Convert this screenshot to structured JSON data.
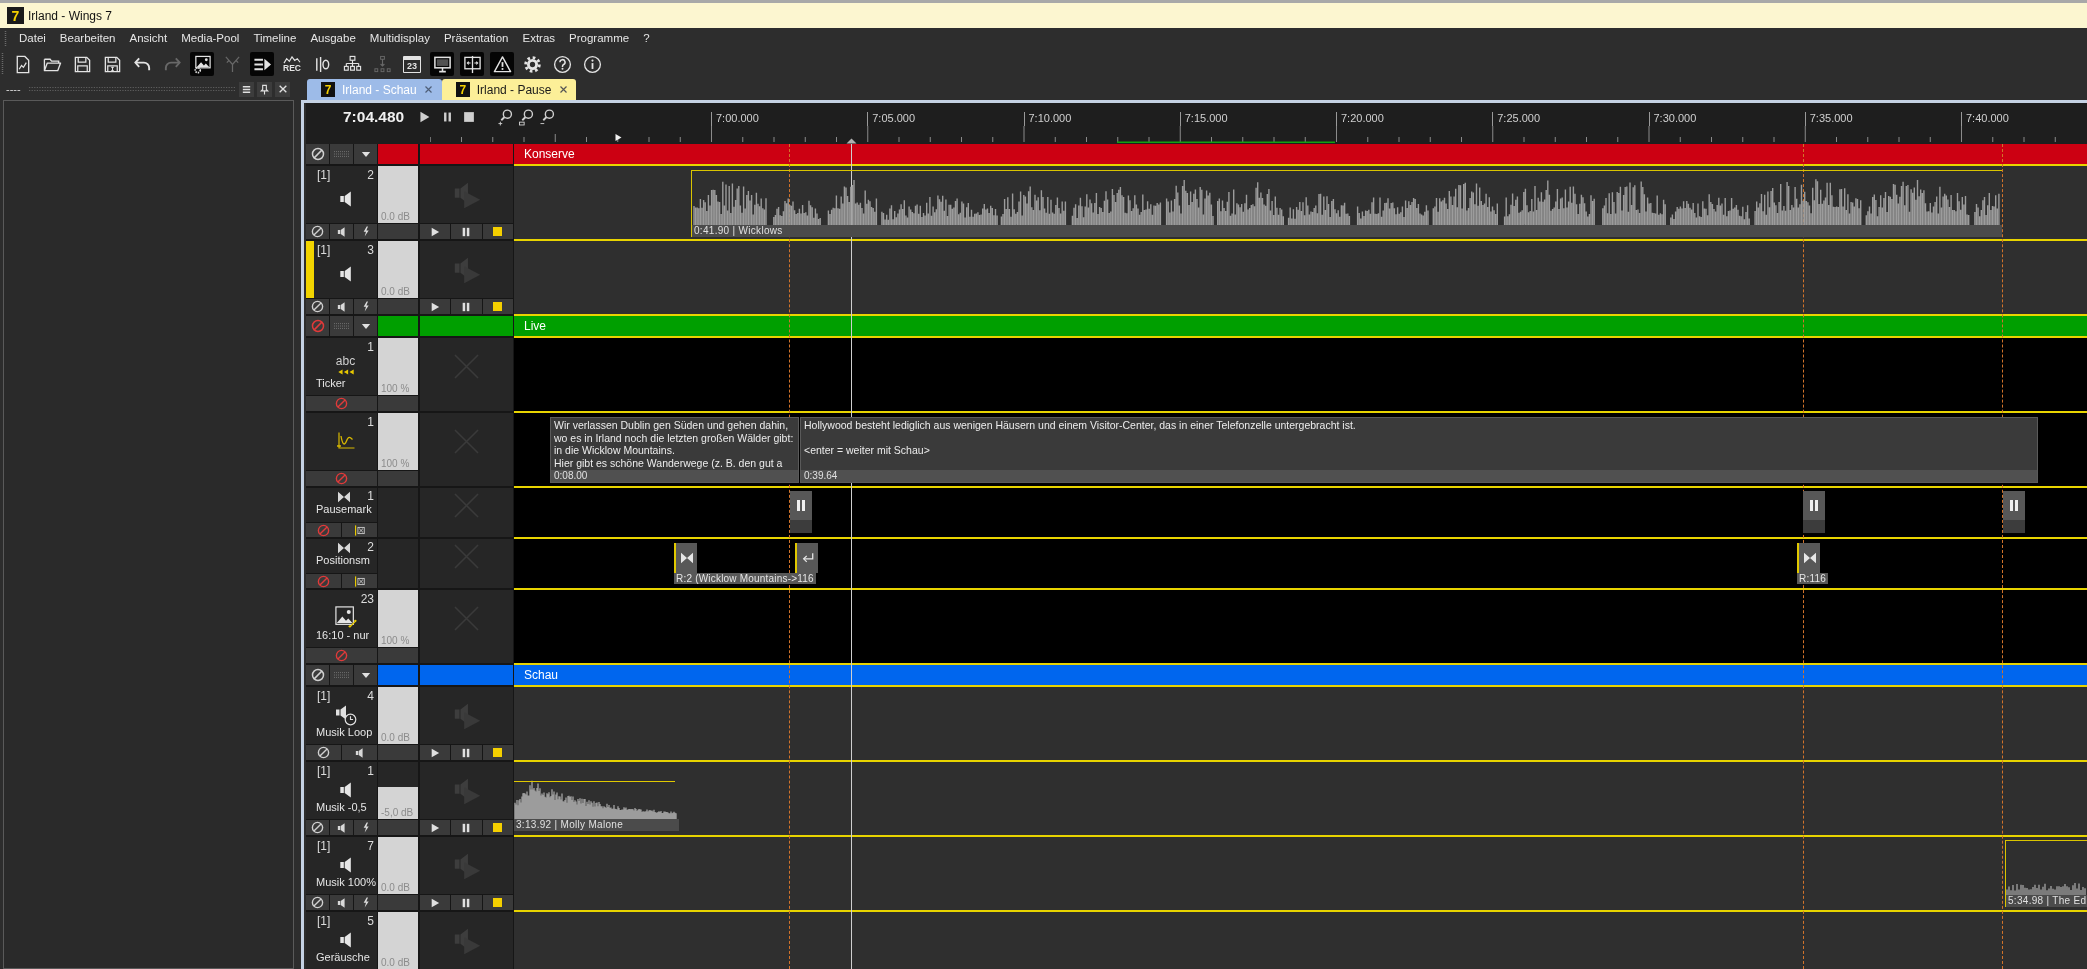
{
  "window": {
    "logo": "7",
    "title": "Irland - Wings 7"
  },
  "menu": [
    "Datei",
    "Bearbeiten",
    "Ansicht",
    "Media-Pool",
    "Timeline",
    "Ausgabe",
    "Multidisplay",
    "Präsentation",
    "Extras",
    "Programme",
    "?"
  ],
  "toolbar": [
    {
      "kind": "new",
      "on": false,
      "disabled": false
    },
    {
      "kind": "open",
      "on": false,
      "disabled": false
    },
    {
      "kind": "save",
      "on": false,
      "disabled": false
    },
    {
      "kind": "save_as",
      "on": false,
      "disabled": false
    },
    {
      "kind": "undo",
      "on": false,
      "disabled": false
    },
    {
      "kind": "redo",
      "on": false,
      "disabled": true
    },
    {
      "kind": "media",
      "on": true,
      "disabled": false
    },
    {
      "kind": "xy",
      "on": false,
      "disabled": true
    },
    {
      "kind": "cue_list",
      "on": true,
      "disabled": false
    },
    {
      "kind": "rec",
      "label": "REC",
      "on": false,
      "disabled": false
    },
    {
      "kind": "level",
      "on": false,
      "disabled": false
    },
    {
      "kind": "hierarchy",
      "on": false,
      "disabled": false
    },
    {
      "kind": "export",
      "on": false,
      "disabled": true
    },
    {
      "kind": "calendar",
      "label": "23",
      "on": false,
      "disabled": false
    },
    {
      "kind": "monitor",
      "on": true,
      "disabled": false
    },
    {
      "kind": "multiscreen",
      "on": true,
      "disabled": false
    },
    {
      "kind": "warning",
      "on": true,
      "disabled": false
    },
    {
      "kind": "settings",
      "on": false,
      "disabled": false
    },
    {
      "kind": "help",
      "on": false,
      "disabled": false
    },
    {
      "kind": "info",
      "on": false,
      "disabled": false
    }
  ],
  "side_panel": {
    "title": "----"
  },
  "tabs": [
    {
      "logo": "7",
      "label": "Irland - Schau",
      "selected": true
    },
    {
      "logo": "7",
      "label": "Irland - Pause",
      "selected": false
    }
  ],
  "transport": {
    "time": "7:04.480"
  },
  "ruler": [
    "7:00.000",
    "7:05.000",
    "7:10.000",
    "7:15.000",
    "7:20.000",
    "7:25.000",
    "7:30.000",
    "7:35.000",
    "7:40.000"
  ],
  "groups": [
    {
      "name": "Konserve",
      "color": "#cc0012",
      "blocked": false,
      "tracks": [
        {
          "kind": "audio",
          "output": "[1]",
          "number": "2",
          "selected": false,
          "timer": false,
          "flash": true,
          "blocked": false,
          "level": 1,
          "reading": "0.0 dB",
          "controls_visible": true,
          "clips": [
            {
              "kind": "audio",
              "label": "0:41.90 | Wicklows"
            }
          ]
        },
        {
          "kind": "audio",
          "output": "[1]",
          "number": "3",
          "selected": true,
          "timer": false,
          "flash": true,
          "blocked": false,
          "level": 1,
          "reading": "0.0 dB",
          "controls_visible": true
        }
      ]
    },
    {
      "name": "Live",
      "color": "#009f00",
      "blocked": true,
      "tracks": [
        {
          "kind": "ticker",
          "number": "1",
          "icon_text": "abc",
          "name": "Ticker",
          "selected": false,
          "blocked": true,
          "level": 1,
          "reading": "100 %",
          "controls_visible": true
        },
        {
          "kind": "text",
          "number": "1",
          "selected": false,
          "blocked": true,
          "level": 1,
          "reading": "100 %",
          "controls_visible": true,
          "clips": [
            {
              "kind": "text",
              "text": "Wir verlassen Dublin gen Süden und gehen dahin,\nwo es in Irland noch die letzten großen Wälder gibt:\nin die Wicklow Mountains.\nHier gibt es schöne Wanderwege (z. B. den gut a",
              "duration": "0:08.00"
            },
            {
              "kind": "text",
              "text": "Hollywood besteht lediglich aus wenigen Häusern und einem Visitor-Center, das in einer Telefonzelle untergebracht ist.\n\n<enter = weiter mit Schau>",
              "duration": "0:39.64"
            }
          ]
        },
        {
          "kind": "pause",
          "number": "1",
          "name": "Pausemark",
          "selected": false,
          "blocked": true,
          "controls_visible": true,
          "clips": [
            {
              "kind": "pause"
            },
            {
              "kind": "pause"
            },
            {
              "kind": "pause"
            }
          ]
        },
        {
          "kind": "position",
          "number": "2",
          "name": "Positionsm",
          "selected": false,
          "blocked": true,
          "controls_visible": true,
          "clips": [
            {
              "kind": "jump",
              "label": "R:2 (Wicklow Mountains->116"
            },
            {
              "kind": "return"
            },
            {
              "kind": "jump",
              "label": "R:116"
            }
          ]
        },
        {
          "kind": "image",
          "number": "23",
          "name": "16:10 - nur",
          "selected": false,
          "blocked": true,
          "level": 1,
          "reading": "100 %",
          "controls_visible": true
        }
      ]
    },
    {
      "name": "Schau",
      "color": "#0066ee",
      "blocked": false,
      "tracks": [
        {
          "kind": "audio",
          "output": "[1]",
          "number": "4",
          "name": "Musik Loop",
          "selected": false,
          "timer": true,
          "flash": false,
          "blocked": false,
          "level": 1,
          "reading": "0.0 dB",
          "controls_visible": true
        },
        {
          "kind": "audio",
          "output": "[1]",
          "number": "1",
          "name": "Musik -0,5",
          "selected": false,
          "timer": false,
          "flash": true,
          "blocked": false,
          "level": 0.56,
          "reading": "-5,0 dB",
          "controls_visible": true,
          "clips": [
            {
              "kind": "audio",
              "label": "3:13.92 | Molly Malone"
            }
          ]
        },
        {
          "kind": "audio",
          "output": "[1]",
          "number": "7",
          "name": "Musik 100%",
          "selected": false,
          "timer": false,
          "flash": true,
          "blocked": false,
          "level": 1,
          "reading": "0.0 dB",
          "controls_visible": true,
          "clips": [
            {
              "kind": "audio",
              "label": "5:34.98 | The Ed"
            }
          ]
        },
        {
          "kind": "audio",
          "output": "[1]",
          "number": "5",
          "name": "Geräusche",
          "selected": false,
          "timer": false,
          "level": 1,
          "reading": "0.0 dB",
          "controls_visible": false
        }
      ]
    }
  ]
}
